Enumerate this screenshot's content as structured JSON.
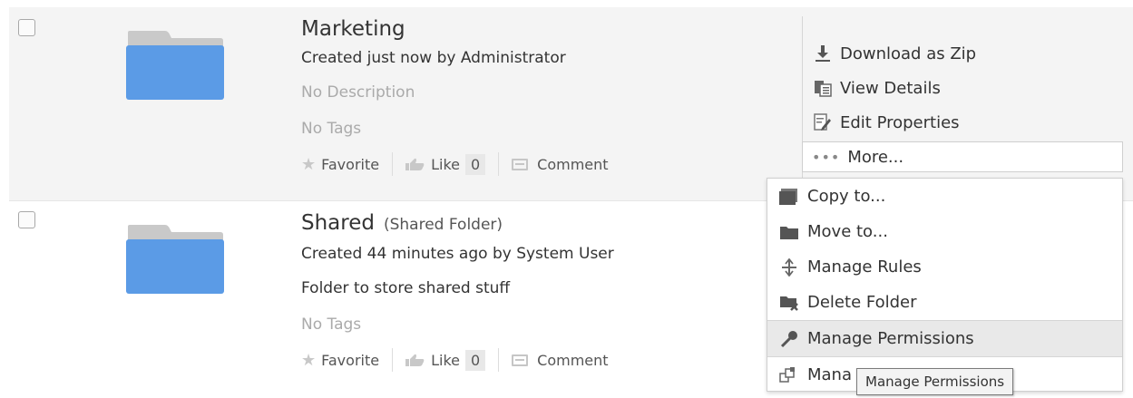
{
  "items": [
    {
      "title": "Marketing",
      "subtitle": "",
      "created": "Created just now by Administrator",
      "description": "No Description",
      "tags": "No Tags",
      "favorite": "Favorite",
      "like": "Like",
      "like_count": "0",
      "comment": "Comment"
    },
    {
      "title": "Shared",
      "subtitle": "(Shared Folder)",
      "created": "Created 44 minutes ago by System User",
      "description": "Folder to store shared stuff",
      "tags": "No Tags",
      "favorite": "Favorite",
      "like": "Like",
      "like_count": "0",
      "comment": "Comment"
    }
  ],
  "actions": {
    "download": "Download as Zip",
    "view_details": "View Details",
    "edit_properties": "Edit Properties",
    "more": "More..."
  },
  "menu": {
    "copy": "Copy to...",
    "move": "Move to...",
    "rules": "Manage Rules",
    "delete": "Delete Folder",
    "permissions": "Manage Permissions",
    "aspects": "Mana"
  },
  "tooltip": "Manage Permissions",
  "colors": {
    "folder_blue": "#5b9be6",
    "folder_tab": "#c9c9c9"
  }
}
